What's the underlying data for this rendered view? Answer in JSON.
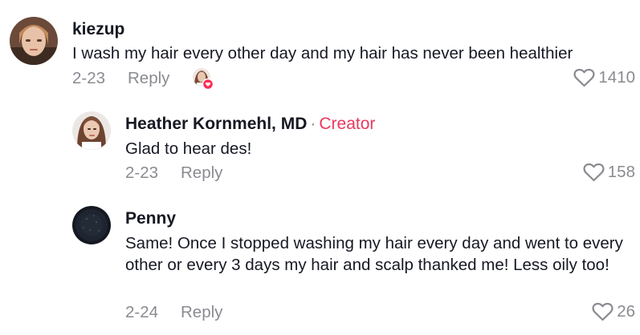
{
  "comments": [
    {
      "username": "kiezup",
      "text": "I wash my hair every other day and my hair has never been healthier",
      "date": "2-23",
      "reply_label": "Reply",
      "likes": "1410"
    },
    {
      "username": "Heather Kornmehl, MD",
      "separator": "·",
      "creator_label": "Creator",
      "text": "Glad to hear des!",
      "date": "2-23",
      "reply_label": "Reply",
      "likes": "158"
    },
    {
      "username": "Penny",
      "text": "Same! Once I stopped washing my hair every day and went to every other or every 3 days my hair and scalp thanked me! Less oily too!",
      "date": "2-24",
      "reply_label": "Reply",
      "likes": "26"
    }
  ],
  "colors": {
    "creator_accent": "#e8395e",
    "muted": "#8a8b91",
    "text": "#161823"
  },
  "icons": {
    "like": "heart-outline-icon",
    "creator_liked": "creator-liked-avatar-icon"
  }
}
